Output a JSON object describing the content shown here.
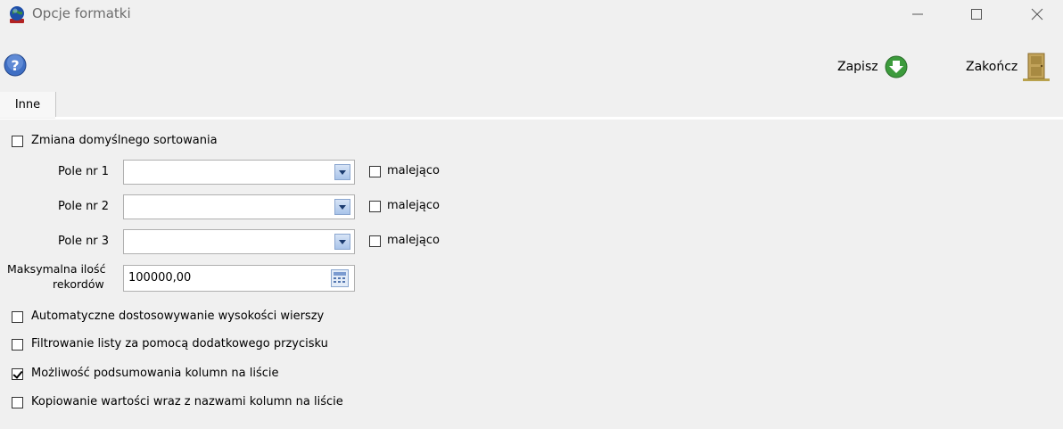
{
  "window": {
    "title": "Opcje formatki",
    "minimize_icon": "minimize-icon",
    "maximize_icon": "maximize-icon",
    "close_icon": "close-icon"
  },
  "toolbar": {
    "help_icon": "help-icon",
    "save_label": "Zapisz",
    "save_icon": "save-arrow-icon",
    "exit_label": "Zakończ",
    "exit_icon": "door-icon"
  },
  "tabs": [
    {
      "label": "Inne",
      "active": true
    }
  ],
  "sorting": {
    "checkbox_label": "Zmiana domyślnego sortowania",
    "checked": false,
    "fields": [
      {
        "label": "Pole nr 1",
        "value": "",
        "desc_label": "malejąco",
        "desc_checked": false
      },
      {
        "label": "Pole nr 2",
        "value": "",
        "desc_label": "malejąco",
        "desc_checked": false
      },
      {
        "label": "Pole nr 3",
        "value": "",
        "desc_label": "malejąco",
        "desc_checked": false
      }
    ]
  },
  "max_records": {
    "label_line1": "Maksymalna ilość",
    "label_line2": "rekordów",
    "value": "100000,00",
    "button_icon": "calculator-icon"
  },
  "options": [
    {
      "label": "Automatyczne dostosowywanie wysokości wierszy",
      "checked": false
    },
    {
      "label": "Filtrowanie listy za pomocą dodatkowego przycisku",
      "checked": false
    },
    {
      "label": "Możliwość podsumowania kolumn na liście",
      "checked": true
    },
    {
      "label": "Kopiowanie wartości wraz z nazwami kolumn na liście",
      "checked": false
    }
  ]
}
